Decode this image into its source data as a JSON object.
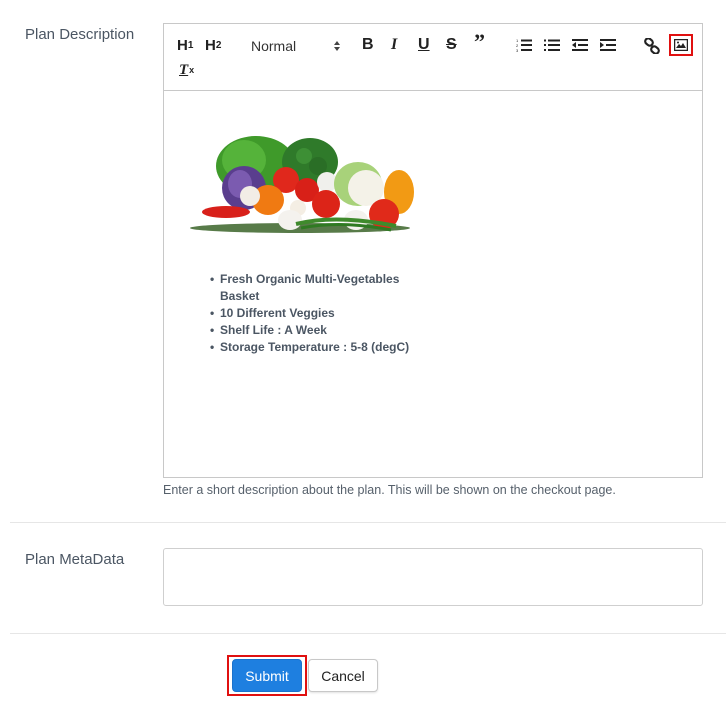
{
  "form": {
    "description_label": "Plan Description",
    "description_help": "Enter a short description about the plan. This will be shown on the checkout page.",
    "metadata_label": "Plan MetaData",
    "metadata_value": ""
  },
  "toolbar": {
    "h1": "H",
    "h1_sub": "1",
    "h2": "H",
    "h2_sub": "2",
    "format_selected": "Normal",
    "bold": "B",
    "italic": "I",
    "underline": "U",
    "strike": "S",
    "quote": "”",
    "clean": "T",
    "clean_sub": "x",
    "highlight_color": "#e01010"
  },
  "editor_content": {
    "image_alt": "Assorted fresh vegetables",
    "bullets": [
      "Fresh Organic Multi-Vegetables Basket",
      "10 Different Veggies",
      "Shelf Life : A Week",
      "Storage Temperature : 5-8 (degC)"
    ]
  },
  "actions": {
    "submit_label": "Submit",
    "cancel_label": "Cancel",
    "submit_color": "#1e7fe0"
  }
}
